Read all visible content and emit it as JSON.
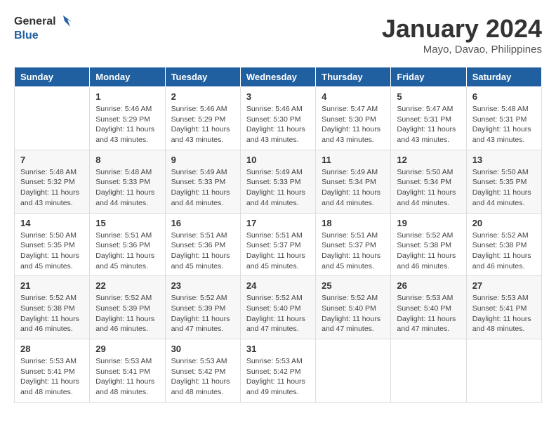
{
  "header": {
    "logo_general": "General",
    "logo_blue": "Blue",
    "month_year": "January 2024",
    "location": "Mayo, Davao, Philippines"
  },
  "columns": [
    "Sunday",
    "Monday",
    "Tuesday",
    "Wednesday",
    "Thursday",
    "Friday",
    "Saturday"
  ],
  "weeks": [
    [
      {
        "day": "",
        "sunrise": "",
        "sunset": "",
        "daylight": ""
      },
      {
        "day": "1",
        "sunrise": "Sunrise: 5:46 AM",
        "sunset": "Sunset: 5:29 PM",
        "daylight": "Daylight: 11 hours and 43 minutes."
      },
      {
        "day": "2",
        "sunrise": "Sunrise: 5:46 AM",
        "sunset": "Sunset: 5:29 PM",
        "daylight": "Daylight: 11 hours and 43 minutes."
      },
      {
        "day": "3",
        "sunrise": "Sunrise: 5:46 AM",
        "sunset": "Sunset: 5:30 PM",
        "daylight": "Daylight: 11 hours and 43 minutes."
      },
      {
        "day": "4",
        "sunrise": "Sunrise: 5:47 AM",
        "sunset": "Sunset: 5:30 PM",
        "daylight": "Daylight: 11 hours and 43 minutes."
      },
      {
        "day": "5",
        "sunrise": "Sunrise: 5:47 AM",
        "sunset": "Sunset: 5:31 PM",
        "daylight": "Daylight: 11 hours and 43 minutes."
      },
      {
        "day": "6",
        "sunrise": "Sunrise: 5:48 AM",
        "sunset": "Sunset: 5:31 PM",
        "daylight": "Daylight: 11 hours and 43 minutes."
      }
    ],
    [
      {
        "day": "7",
        "sunrise": "Sunrise: 5:48 AM",
        "sunset": "Sunset: 5:32 PM",
        "daylight": "Daylight: 11 hours and 43 minutes."
      },
      {
        "day": "8",
        "sunrise": "Sunrise: 5:48 AM",
        "sunset": "Sunset: 5:33 PM",
        "daylight": "Daylight: 11 hours and 44 minutes."
      },
      {
        "day": "9",
        "sunrise": "Sunrise: 5:49 AM",
        "sunset": "Sunset: 5:33 PM",
        "daylight": "Daylight: 11 hours and 44 minutes."
      },
      {
        "day": "10",
        "sunrise": "Sunrise: 5:49 AM",
        "sunset": "Sunset: 5:33 PM",
        "daylight": "Daylight: 11 hours and 44 minutes."
      },
      {
        "day": "11",
        "sunrise": "Sunrise: 5:49 AM",
        "sunset": "Sunset: 5:34 PM",
        "daylight": "Daylight: 11 hours and 44 minutes."
      },
      {
        "day": "12",
        "sunrise": "Sunrise: 5:50 AM",
        "sunset": "Sunset: 5:34 PM",
        "daylight": "Daylight: 11 hours and 44 minutes."
      },
      {
        "day": "13",
        "sunrise": "Sunrise: 5:50 AM",
        "sunset": "Sunset: 5:35 PM",
        "daylight": "Daylight: 11 hours and 44 minutes."
      }
    ],
    [
      {
        "day": "14",
        "sunrise": "Sunrise: 5:50 AM",
        "sunset": "Sunset: 5:35 PM",
        "daylight": "Daylight: 11 hours and 45 minutes."
      },
      {
        "day": "15",
        "sunrise": "Sunrise: 5:51 AM",
        "sunset": "Sunset: 5:36 PM",
        "daylight": "Daylight: 11 hours and 45 minutes."
      },
      {
        "day": "16",
        "sunrise": "Sunrise: 5:51 AM",
        "sunset": "Sunset: 5:36 PM",
        "daylight": "Daylight: 11 hours and 45 minutes."
      },
      {
        "day": "17",
        "sunrise": "Sunrise: 5:51 AM",
        "sunset": "Sunset: 5:37 PM",
        "daylight": "Daylight: 11 hours and 45 minutes."
      },
      {
        "day": "18",
        "sunrise": "Sunrise: 5:51 AM",
        "sunset": "Sunset: 5:37 PM",
        "daylight": "Daylight: 11 hours and 45 minutes."
      },
      {
        "day": "19",
        "sunrise": "Sunrise: 5:52 AM",
        "sunset": "Sunset: 5:38 PM",
        "daylight": "Daylight: 11 hours and 46 minutes."
      },
      {
        "day": "20",
        "sunrise": "Sunrise: 5:52 AM",
        "sunset": "Sunset: 5:38 PM",
        "daylight": "Daylight: 11 hours and 46 minutes."
      }
    ],
    [
      {
        "day": "21",
        "sunrise": "Sunrise: 5:52 AM",
        "sunset": "Sunset: 5:38 PM",
        "daylight": "Daylight: 11 hours and 46 minutes."
      },
      {
        "day": "22",
        "sunrise": "Sunrise: 5:52 AM",
        "sunset": "Sunset: 5:39 PM",
        "daylight": "Daylight: 11 hours and 46 minutes."
      },
      {
        "day": "23",
        "sunrise": "Sunrise: 5:52 AM",
        "sunset": "Sunset: 5:39 PM",
        "daylight": "Daylight: 11 hours and 47 minutes."
      },
      {
        "day": "24",
        "sunrise": "Sunrise: 5:52 AM",
        "sunset": "Sunset: 5:40 PM",
        "daylight": "Daylight: 11 hours and 47 minutes."
      },
      {
        "day": "25",
        "sunrise": "Sunrise: 5:52 AM",
        "sunset": "Sunset: 5:40 PM",
        "daylight": "Daylight: 11 hours and 47 minutes."
      },
      {
        "day": "26",
        "sunrise": "Sunrise: 5:53 AM",
        "sunset": "Sunset: 5:40 PM",
        "daylight": "Daylight: 11 hours and 47 minutes."
      },
      {
        "day": "27",
        "sunrise": "Sunrise: 5:53 AM",
        "sunset": "Sunset: 5:41 PM",
        "daylight": "Daylight: 11 hours and 48 minutes."
      }
    ],
    [
      {
        "day": "28",
        "sunrise": "Sunrise: 5:53 AM",
        "sunset": "Sunset: 5:41 PM",
        "daylight": "Daylight: 11 hours and 48 minutes."
      },
      {
        "day": "29",
        "sunrise": "Sunrise: 5:53 AM",
        "sunset": "Sunset: 5:41 PM",
        "daylight": "Daylight: 11 hours and 48 minutes."
      },
      {
        "day": "30",
        "sunrise": "Sunrise: 5:53 AM",
        "sunset": "Sunset: 5:42 PM",
        "daylight": "Daylight: 11 hours and 48 minutes."
      },
      {
        "day": "31",
        "sunrise": "Sunrise: 5:53 AM",
        "sunset": "Sunset: 5:42 PM",
        "daylight": "Daylight: 11 hours and 49 minutes."
      },
      {
        "day": "",
        "sunrise": "",
        "sunset": "",
        "daylight": ""
      },
      {
        "day": "",
        "sunrise": "",
        "sunset": "",
        "daylight": ""
      },
      {
        "day": "",
        "sunrise": "",
        "sunset": "",
        "daylight": ""
      }
    ]
  ]
}
